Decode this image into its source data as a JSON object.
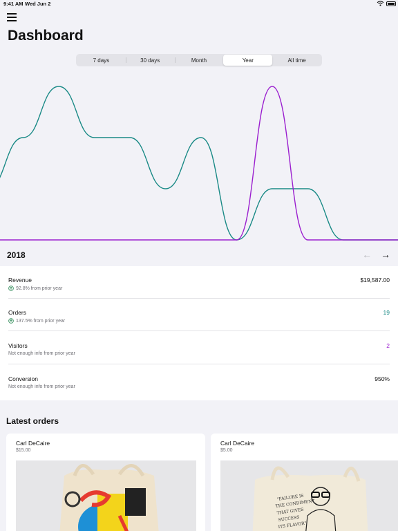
{
  "status_bar": {
    "time": "9:41 AM",
    "date": "Wed Jun 2"
  },
  "header": {
    "title": "Dashboard"
  },
  "period_tabs": [
    {
      "label": "7 days"
    },
    {
      "label": "30 days"
    },
    {
      "label": "Month"
    },
    {
      "label": "Year"
    },
    {
      "label": "All time"
    }
  ],
  "selected_period": "Year",
  "colors": {
    "teal": "#1a8a86",
    "purple": "#9b1fcf",
    "positive": "#2e8b57"
  },
  "chart_data": {
    "type": "line",
    "title": "",
    "xlabel": "",
    "ylabel": "",
    "grid": false,
    "legend": "none",
    "x": [
      1,
      2,
      3,
      4,
      5,
      6,
      7,
      8,
      9,
      10,
      11,
      12
    ],
    "ylim": [
      0,
      12
    ],
    "series": [
      {
        "color": "#1a8a86",
        "values": [
          4,
          8,
          12,
          8,
          8,
          4,
          8,
          0,
          4,
          4,
          0,
          0
        ]
      },
      {
        "color": "#9b1fcf",
        "values": [
          0,
          0,
          0,
          0,
          0,
          0,
          0,
          0,
          12,
          0,
          0,
          0
        ]
      }
    ]
  },
  "period": {
    "year": "2018"
  },
  "stats": [
    {
      "name": "Revenue",
      "sub": "92.8% from prior year",
      "trend": "up",
      "value": "$19,587.00",
      "color": "#111111"
    },
    {
      "name": "Orders",
      "sub": "137.5% from prior year",
      "trend": "up",
      "value": "19",
      "color": "#1a8a86"
    },
    {
      "name": "Visitors",
      "sub": "Not enough info from prior year",
      "trend": "none",
      "value": "2",
      "color": "#9b1fcf"
    },
    {
      "name": "Conversion",
      "sub": "Not enough info from prior year",
      "trend": "none",
      "value": "950%",
      "color": "#111111"
    }
  ],
  "latest_orders": {
    "title": "Latest orders",
    "items": [
      {
        "customer": "Carl DeCaire",
        "price": "$15.00",
        "image": "tote-bag-abstract-print"
      },
      {
        "customer": "Carl DeCaire",
        "price": "$5.00",
        "image": "tote-bag-portrait-print",
        "print_text": "\"FAILURE IS THE CONDIMENT THAT GIVES SUCCESS ITS FLAVOR\""
      }
    ]
  }
}
